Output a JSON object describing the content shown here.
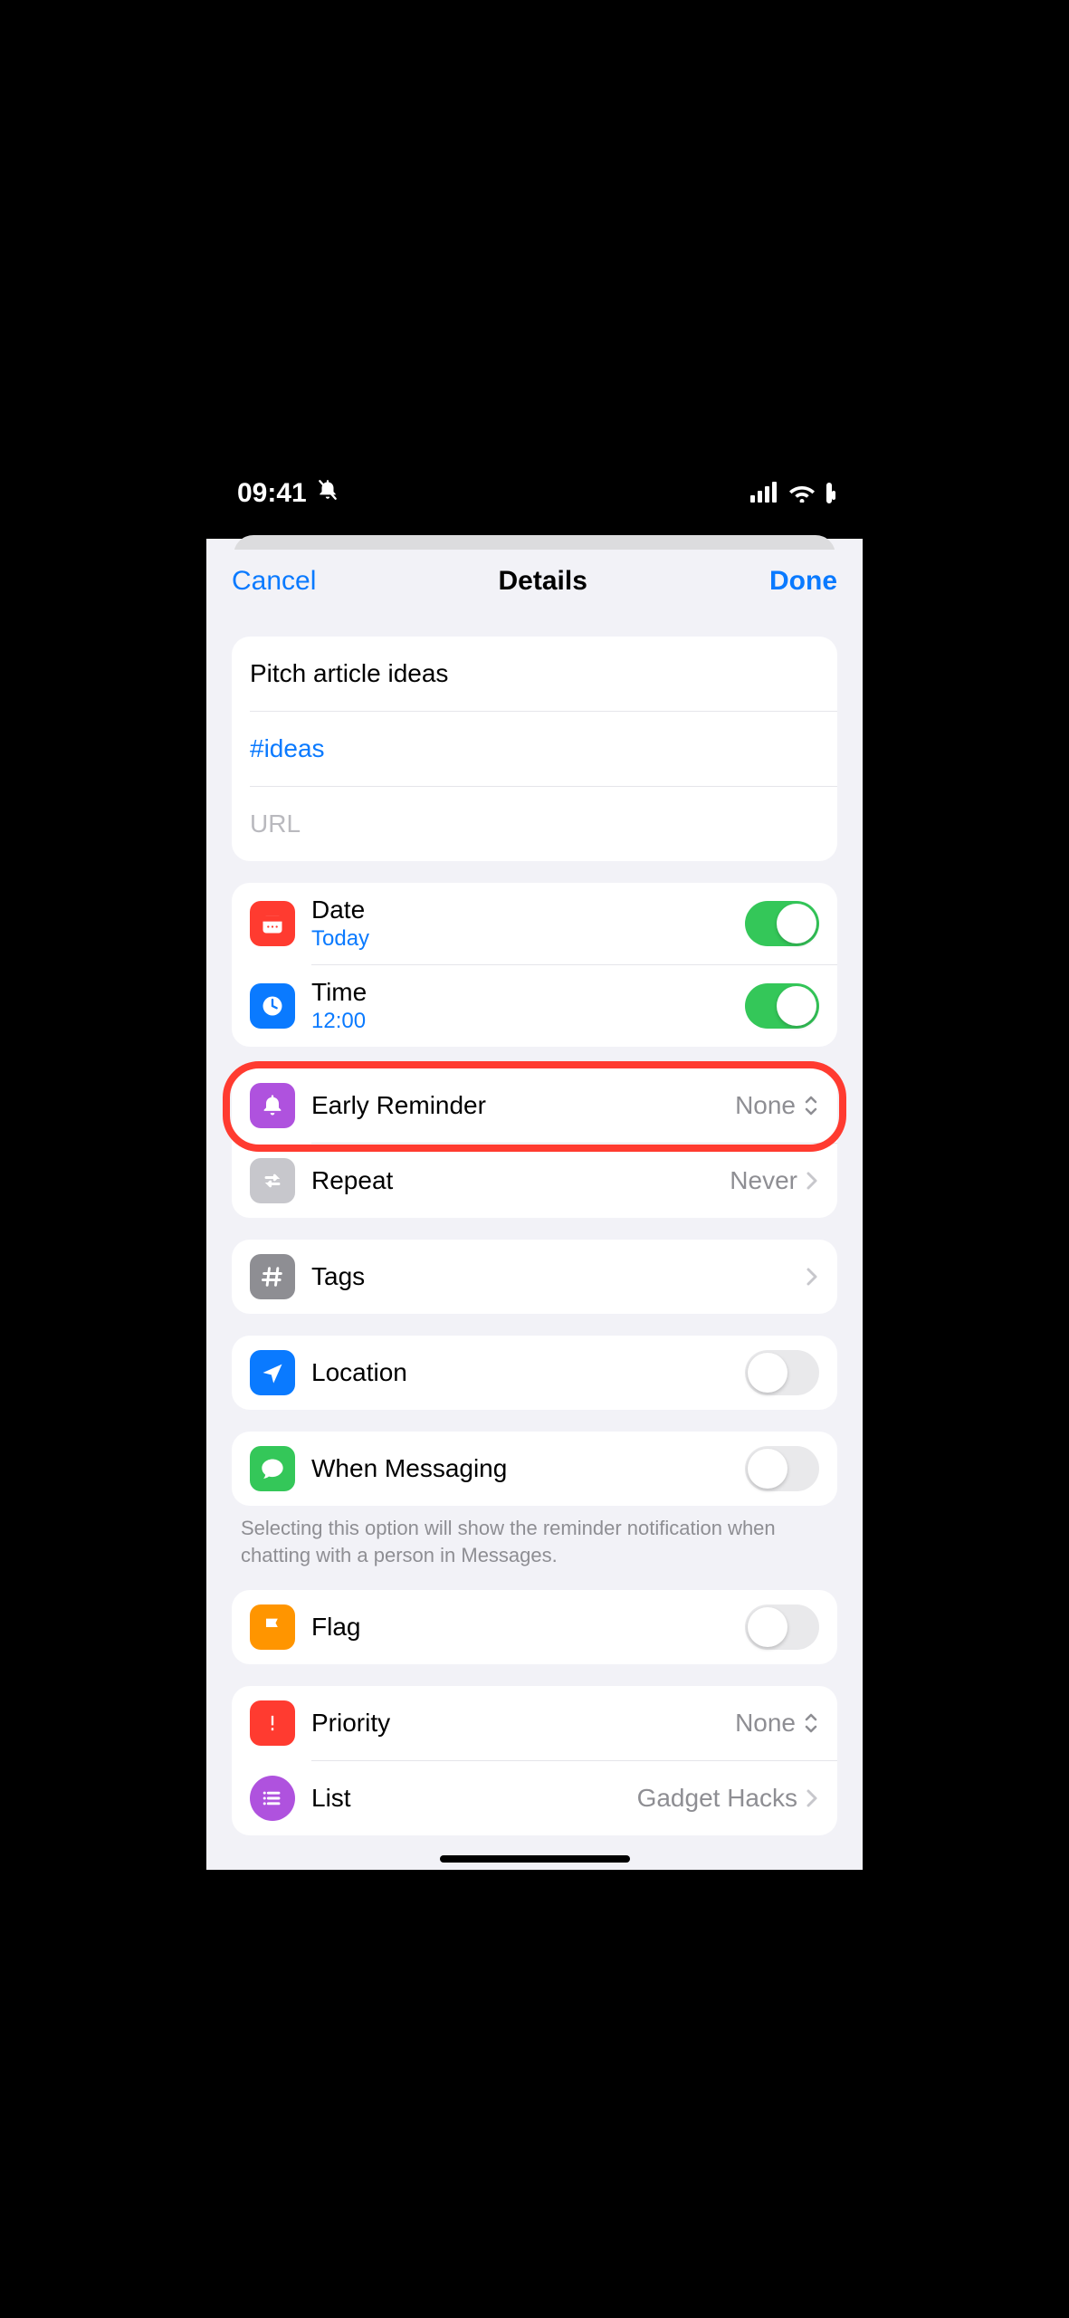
{
  "status": {
    "time": "09:41"
  },
  "nav": {
    "cancel": "Cancel",
    "title": "Details",
    "done": "Done"
  },
  "main": {
    "title": "Pitch article ideas",
    "notes": "#ideas",
    "url_placeholder": "URL"
  },
  "datetime": {
    "date_label": "Date",
    "date_value": "Today",
    "date_on": true,
    "time_label": "Time",
    "time_value": "12:00",
    "time_on": true
  },
  "early_reminder": {
    "label": "Early Reminder",
    "value": "None"
  },
  "repeat": {
    "label": "Repeat",
    "value": "Never"
  },
  "tags": {
    "label": "Tags"
  },
  "location": {
    "label": "Location",
    "on": false
  },
  "messaging": {
    "label": "When Messaging",
    "on": false,
    "note": "Selecting this option will show the reminder notification when chatting with a person in Messages."
  },
  "flag": {
    "label": "Flag",
    "on": false
  },
  "priority": {
    "label": "Priority",
    "value": "None"
  },
  "list": {
    "label": "List",
    "value": "Gadget Hacks"
  }
}
